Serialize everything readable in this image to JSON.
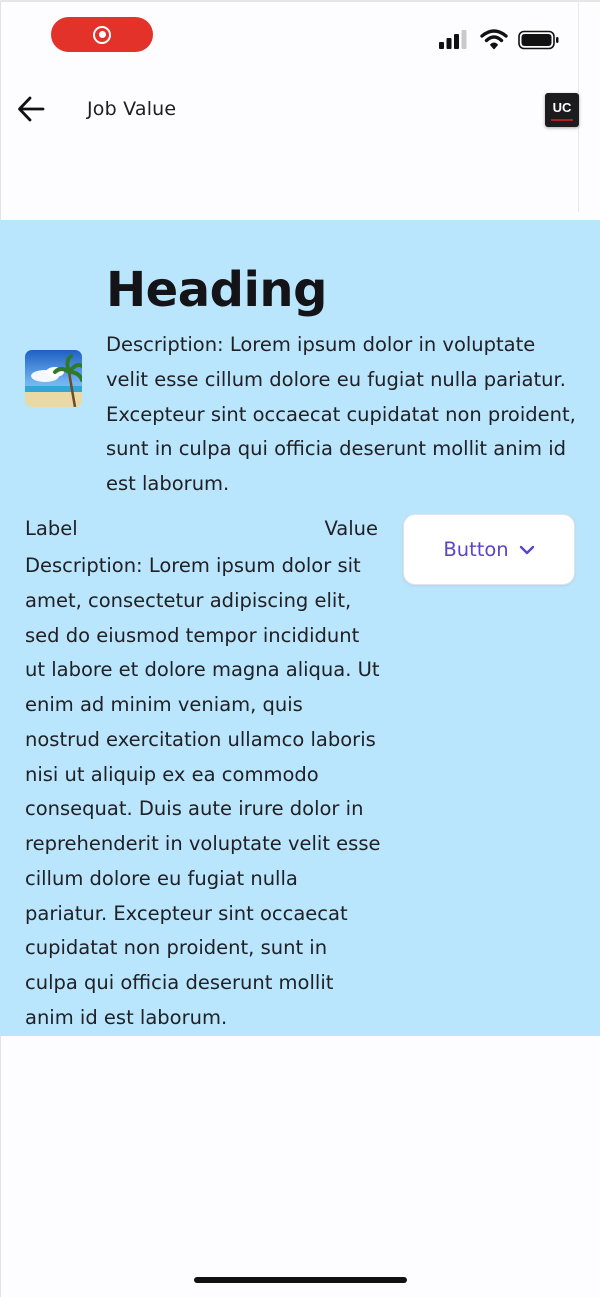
{
  "app_bar": {
    "title": "Job Value",
    "badge": "UC"
  },
  "hero": {
    "heading": "Heading",
    "description": "Description: Lorem ipsum dolor in voluptate velit esse cillum dolore eu fugiat nulla pariatur. Excepteur sint occaecat cupidatat non proident, sunt in culpa qui officia deserunt mollit anim id est laborum."
  },
  "detail": {
    "label": "Label",
    "value": "Value",
    "description": "Description: Lorem ipsum dolor sit amet, consectetur adipiscing elit, sed do eiusmod tempor incididunt ut labore et dolore magna aliqua. Ut enim ad minim veniam, quis nostrud exercitation ullamco laboris nisi ut aliquip ex ea commodo consequat. Duis aute irure dolor in reprehenderit in voluptate velit esse cillum dolore eu fugiat nulla pariatur. Excepteur sint occaecat cupidatat non proident, sunt in culpa qui officia deserunt mollit anim id est laborum.",
    "button_label": "Button"
  },
  "colors": {
    "section_background": "#bae6fd",
    "button_text": "#5a46c8",
    "record_indicator": "#e2322a"
  },
  "icons": [
    "record-icon",
    "signal-icon",
    "wifi-icon",
    "battery-icon",
    "back-arrow-icon",
    "chevron-down-icon",
    "beach-image"
  ]
}
